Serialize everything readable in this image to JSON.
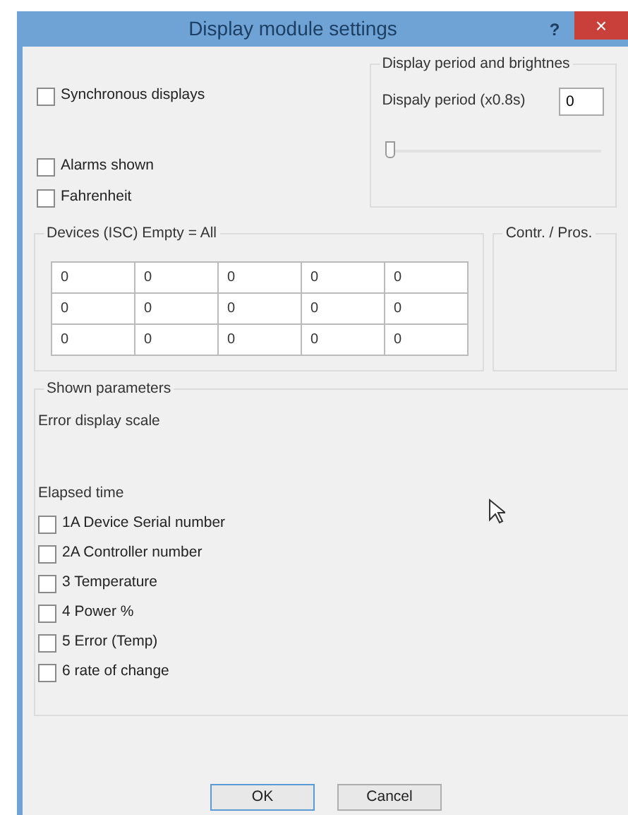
{
  "window": {
    "title": "Display module settings",
    "help": "?",
    "close": "×"
  },
  "options": [
    {
      "label": "Synchronous displays",
      "checked": false
    },
    {
      "label": "Alarms shown",
      "checked": false
    },
    {
      "label": "Fahrenheit",
      "checked": false
    }
  ],
  "display_group": {
    "legend": "Display period and brightnes",
    "period_label": "Dispaly period (x0.8s)",
    "period_value": "0",
    "brightness": {
      "level": 0
    }
  },
  "devices": {
    "legend": "Devices (ISC) Empty = All",
    "rows": [
      [
        "0",
        "0",
        "0",
        "0",
        "0"
      ],
      [
        "0",
        "0",
        "0",
        "0",
        "0"
      ],
      [
        "0",
        "0",
        "0",
        "0",
        "0"
      ]
    ]
  },
  "contr_group": {
    "legend": "Contr. / Pros."
  },
  "shown_parameters": {
    "legend": "Shown parameters",
    "error_scale_label": "Error display scale",
    "elapsed_label": "Elapsed time",
    "items": [
      {
        "label": "1A Device Serial number",
        "checked": false
      },
      {
        "label": "2A Controller number",
        "checked": false
      },
      {
        "label": "3 Temperature",
        "checked": false
      },
      {
        "label": "4 Power %",
        "checked": false
      },
      {
        "label": "5 Error (Temp)",
        "checked": false
      },
      {
        "label": "6 rate of change",
        "checked": false
      }
    ]
  },
  "buttons": [
    {
      "label": "OK",
      "default": true
    },
    {
      "label": "Cancel",
      "default": false
    }
  ]
}
